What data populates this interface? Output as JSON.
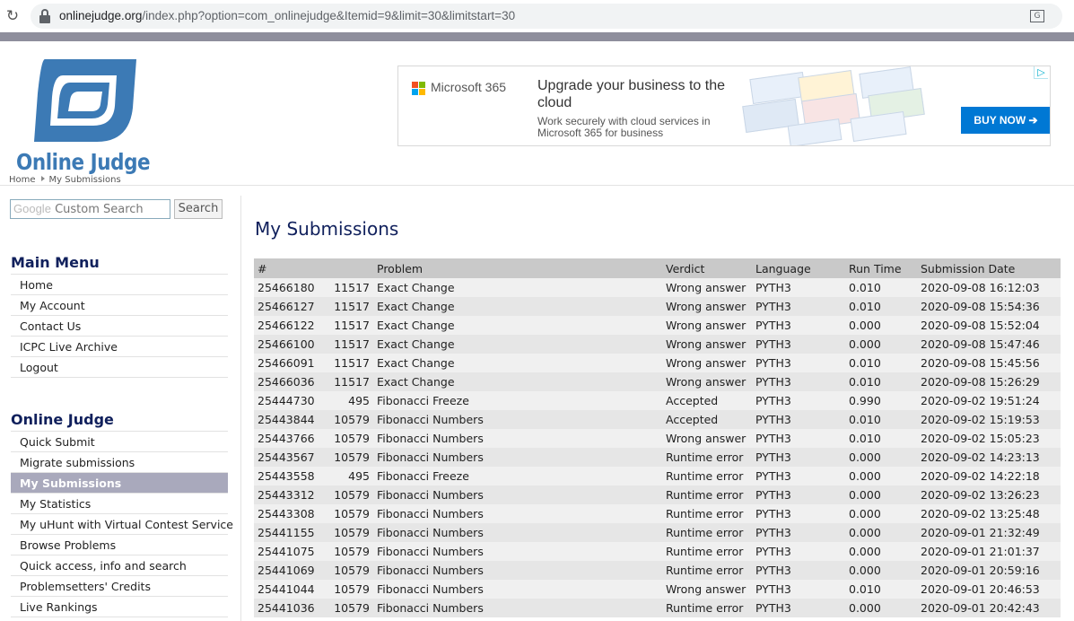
{
  "browser": {
    "url_host": "onlinejudge.org",
    "url_rest": "/index.php?option=com_onlinejudge&Itemid=9&limit=30&limitstart=30"
  },
  "header": {
    "logo_text": "Online Judge",
    "breadcrumb": [
      "Home",
      "My Submissions"
    ]
  },
  "ad": {
    "brand": "Microsoft 365",
    "headline": "Upgrade your business to the cloud",
    "subtext": "Work securely with cloud services in Microsoft 365 for business",
    "cta": "BUY NOW ➔",
    "colors": {
      "cta": "#0078d4"
    }
  },
  "search": {
    "placeholder_brand": "Google",
    "placeholder": "Custom Search",
    "button": "Search"
  },
  "main_menu": {
    "heading": "Main Menu",
    "items": [
      "Home",
      "My Account",
      "Contact Us",
      "ICPC Live Archive",
      "Logout"
    ]
  },
  "oj_menu": {
    "heading": "Online Judge",
    "items": [
      "Quick Submit",
      "Migrate submissions",
      "My Submissions",
      "My Statistics",
      "My uHunt with Virtual Contest Service",
      "Browse Problems",
      "Quick access, info and search",
      "Problemsetters' Credits",
      "Live Rankings"
    ],
    "active_item": "My Submissions"
  },
  "main": {
    "title": "My Submissions",
    "columns": [
      "#",
      "Problem",
      "Verdict",
      "Language",
      "Run Time",
      "Submission Date"
    ],
    "rows": [
      {
        "id": "25466180",
        "pid": "11517",
        "name": "Exact Change",
        "verdict": "Wrong answer",
        "lang": "PYTH3",
        "time": "0.010",
        "date": "2020-09-08 16:12:03"
      },
      {
        "id": "25466127",
        "pid": "11517",
        "name": "Exact Change",
        "verdict": "Wrong answer",
        "lang": "PYTH3",
        "time": "0.010",
        "date": "2020-09-08 15:54:36"
      },
      {
        "id": "25466122",
        "pid": "11517",
        "name": "Exact Change",
        "verdict": "Wrong answer",
        "lang": "PYTH3",
        "time": "0.000",
        "date": "2020-09-08 15:52:04"
      },
      {
        "id": "25466100",
        "pid": "11517",
        "name": "Exact Change",
        "verdict": "Wrong answer",
        "lang": "PYTH3",
        "time": "0.000",
        "date": "2020-09-08 15:47:46"
      },
      {
        "id": "25466091",
        "pid": "11517",
        "name": "Exact Change",
        "verdict": "Wrong answer",
        "lang": "PYTH3",
        "time": "0.010",
        "date": "2020-09-08 15:45:56"
      },
      {
        "id": "25466036",
        "pid": "11517",
        "name": "Exact Change",
        "verdict": "Wrong answer",
        "lang": "PYTH3",
        "time": "0.010",
        "date": "2020-09-08 15:26:29"
      },
      {
        "id": "25444730",
        "pid": "495",
        "name": "Fibonacci Freeze",
        "verdict": "Accepted",
        "lang": "PYTH3",
        "time": "0.990",
        "date": "2020-09-02 19:51:24"
      },
      {
        "id": "25443844",
        "pid": "10579",
        "name": "Fibonacci Numbers",
        "verdict": "Accepted",
        "lang": "PYTH3",
        "time": "0.010",
        "date": "2020-09-02 15:19:53"
      },
      {
        "id": "25443766",
        "pid": "10579",
        "name": "Fibonacci Numbers",
        "verdict": "Wrong answer",
        "lang": "PYTH3",
        "time": "0.010",
        "date": "2020-09-02 15:05:23"
      },
      {
        "id": "25443567",
        "pid": "10579",
        "name": "Fibonacci Numbers",
        "verdict": "Runtime error",
        "lang": "PYTH3",
        "time": "0.000",
        "date": "2020-09-02 14:23:13"
      },
      {
        "id": "25443558",
        "pid": "495",
        "name": "Fibonacci Freeze",
        "verdict": "Runtime error",
        "lang": "PYTH3",
        "time": "0.000",
        "date": "2020-09-02 14:22:18"
      },
      {
        "id": "25443312",
        "pid": "10579",
        "name": "Fibonacci Numbers",
        "verdict": "Runtime error",
        "lang": "PYTH3",
        "time": "0.000",
        "date": "2020-09-02 13:26:23"
      },
      {
        "id": "25443308",
        "pid": "10579",
        "name": "Fibonacci Numbers",
        "verdict": "Runtime error",
        "lang": "PYTH3",
        "time": "0.000",
        "date": "2020-09-02 13:25:48"
      },
      {
        "id": "25441155",
        "pid": "10579",
        "name": "Fibonacci Numbers",
        "verdict": "Runtime error",
        "lang": "PYTH3",
        "time": "0.000",
        "date": "2020-09-01 21:32:49"
      },
      {
        "id": "25441075",
        "pid": "10579",
        "name": "Fibonacci Numbers",
        "verdict": "Runtime error",
        "lang": "PYTH3",
        "time": "0.000",
        "date": "2020-09-01 21:01:37"
      },
      {
        "id": "25441069",
        "pid": "10579",
        "name": "Fibonacci Numbers",
        "verdict": "Runtime error",
        "lang": "PYTH3",
        "time": "0.000",
        "date": "2020-09-01 20:59:16"
      },
      {
        "id": "25441044",
        "pid": "10579",
        "name": "Fibonacci Numbers",
        "verdict": "Wrong answer",
        "lang": "PYTH3",
        "time": "0.010",
        "date": "2020-09-01 20:46:53"
      },
      {
        "id": "25441036",
        "pid": "10579",
        "name": "Fibonacci Numbers",
        "verdict": "Runtime error",
        "lang": "PYTH3",
        "time": "0.000",
        "date": "2020-09-01 20:42:43"
      }
    ]
  }
}
